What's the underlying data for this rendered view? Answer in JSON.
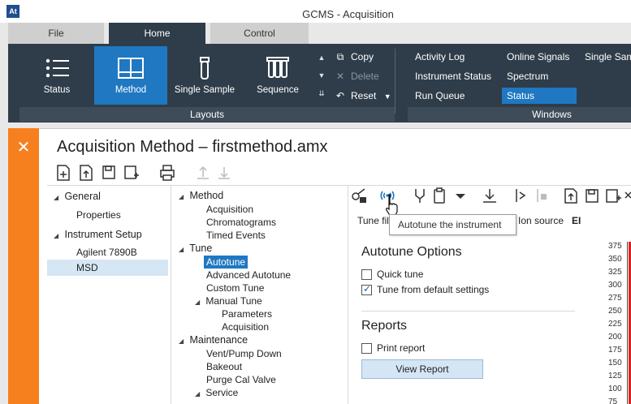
{
  "window": {
    "title": "GCMS - Acquisition",
    "app_icon": "At"
  },
  "tabs": [
    {
      "label": "File"
    },
    {
      "label": "Home"
    },
    {
      "label": "Control"
    }
  ],
  "ribbon": {
    "layouts": [
      {
        "label": "Status",
        "icon": "list-icon"
      },
      {
        "label": "Method",
        "icon": "method-book-icon"
      },
      {
        "label": "Single Sample",
        "icon": "vial-icon"
      },
      {
        "label": "Sequence",
        "icon": "vials-icon"
      }
    ],
    "commands": [
      {
        "label": "Copy",
        "icon": "copy-icon"
      },
      {
        "label": "Delete",
        "icon": "delete-icon"
      },
      {
        "label": "Reset",
        "icon": "reset-icon"
      }
    ],
    "windows_col1": [
      "Activity Log",
      "Instrument Status",
      "Run Queue"
    ],
    "windows_col2": [
      "Online Signals",
      "Spectrum",
      "Status"
    ],
    "windows_col3": [
      "Single Sam"
    ],
    "groups": {
      "layouts": "Layouts",
      "windows": "Windows"
    }
  },
  "document": {
    "title": "Acquisition Method – firstmethod.amx",
    "close_glyph": "✕"
  },
  "left_tree": {
    "general": "General",
    "properties": "Properties",
    "instrument_setup": "Instrument Setup",
    "agilent": "Agilent 7890B",
    "msd": "MSD"
  },
  "method_tree": {
    "method": "Method",
    "acquisition": "Acquisition",
    "chromatograms": "Chromatograms",
    "timed_events": "Timed Events",
    "tune": "Tune",
    "autotune": "Autotune",
    "advanced_autotune": "Advanced Autotune",
    "custom_tune": "Custom Tune",
    "manual_tune": "Manual Tune",
    "parameters": "Parameters",
    "manual_acquisition": "Acquisition",
    "maintenance": "Maintenance",
    "vent_pump_down": "Vent/Pump Down",
    "bakeout": "Bakeout",
    "purge_cal_valve": "Purge Cal Valve",
    "service": "Service"
  },
  "tune_panel": {
    "tooltip": "Autotune the instrument",
    "tune_file_label": "Tune fil",
    "ion_source_label": "Ion source",
    "ion_source_value": "EI",
    "autotune_options_title": "Autotune Options",
    "quick_tune": {
      "label": "Quick tune",
      "checked": false
    },
    "tune_from_default": {
      "label": "Tune from default settings",
      "checked": true
    },
    "reports_title": "Reports",
    "print_report": {
      "label": "Print report",
      "checked": false
    },
    "view_report_button": "View Report"
  },
  "chart_axis": {
    "ticks": [
      "375",
      "350",
      "325",
      "300",
      "275",
      "250",
      "225",
      "200",
      "175",
      "150",
      "125",
      "100",
      "75"
    ]
  },
  "colors": {
    "accent": "#1f78c1",
    "ribbon_bg": "#2f3d4a",
    "orange": "#f7801e"
  }
}
